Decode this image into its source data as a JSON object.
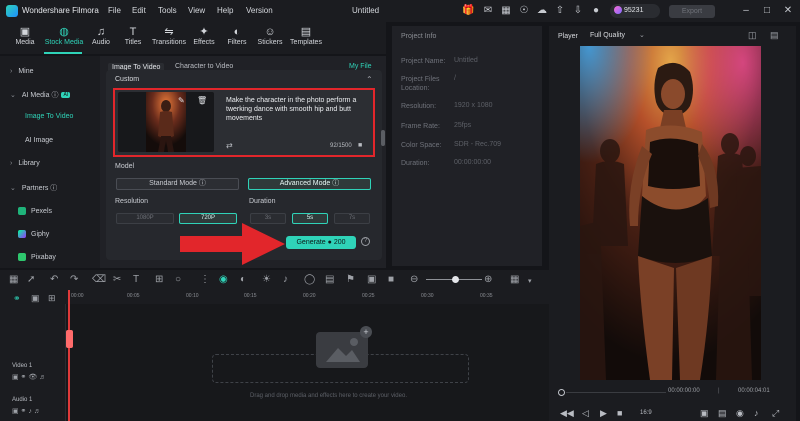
{
  "app": {
    "title": "Wondershare Filmora",
    "menu": [
      "File",
      "Edit",
      "Tools",
      "View",
      "Help",
      "Version"
    ],
    "document_title": "Untitled",
    "credits": "95231",
    "export_label": "Export"
  },
  "media_toolbar": {
    "tabs": [
      {
        "label": "Media",
        "icon": "media-icon"
      },
      {
        "label": "Stock Media",
        "icon": "stock-media-icon"
      },
      {
        "label": "Audio",
        "icon": "audio-icon"
      },
      {
        "label": "Titles",
        "icon": "titles-icon"
      },
      {
        "label": "Transitions",
        "icon": "transitions-icon"
      },
      {
        "label": "Effects",
        "icon": "effects-icon"
      },
      {
        "label": "Filters",
        "icon": "filters-icon"
      },
      {
        "label": "Stickers",
        "icon": "stickers-icon"
      },
      {
        "label": "Templates",
        "icon": "templates-icon"
      }
    ],
    "active": "Stock Media"
  },
  "left_nav": {
    "mine": "Mine",
    "ai_media": "AI Media",
    "ai_badge": "AI",
    "image_to_video": "Image To Video",
    "ai_image": "AI Image",
    "library": "Library",
    "partners": "Partners",
    "pexels": "Pexels",
    "giphy": "Giphy",
    "pixabay": "Pixabay"
  },
  "panel": {
    "tabs": [
      "Image To Video",
      "Character to Video"
    ],
    "my_file": "My File",
    "section": "Custom",
    "prompt": "Make the character in the photo perform a twerking dance with smooth hip and butt movements",
    "counter": "92/1500",
    "model_label": "Model",
    "standard_mode": "Standard Mode",
    "advanced_mode": "Advanced Mode",
    "resolution_label": "Resolution",
    "resolutions": [
      "1080P",
      "720P"
    ],
    "duration_label": "Duration",
    "durations": [
      "3s",
      "5s",
      "7s"
    ],
    "generate_label": "Generate",
    "generate_cost": "200"
  },
  "project_info": {
    "header": "Project Info",
    "rows": [
      {
        "key": "Project Name:",
        "value": "Untitled"
      },
      {
        "key": "Project Files Location:",
        "value": "/"
      },
      {
        "key": "Resolution:",
        "value": "1920 x 1080"
      },
      {
        "key": "Frame Rate:",
        "value": "25fps"
      },
      {
        "key": "Color Space:",
        "value": "SDR - Rec.709"
      },
      {
        "key": "Duration:",
        "value": "00:00:00:00"
      }
    ]
  },
  "player": {
    "label": "Player",
    "quality": "Full Quality",
    "current_time": "00:00:00:00",
    "total_time": "00:00:04:01",
    "ratio": "16:9"
  },
  "timeline": {
    "ticks": [
      "00:00",
      "00:05",
      "00:10",
      "00:15",
      "00:20",
      "00:25",
      "00:30",
      "00:35"
    ],
    "video_track": "Video 1",
    "audio_track": "Audio 1",
    "drop_hint": "Drag and drop media and effects here to create your video."
  },
  "colors": {
    "accent": "#2fd3b8",
    "highlight_box": "#e2262b",
    "arrow": "#e2262b"
  }
}
